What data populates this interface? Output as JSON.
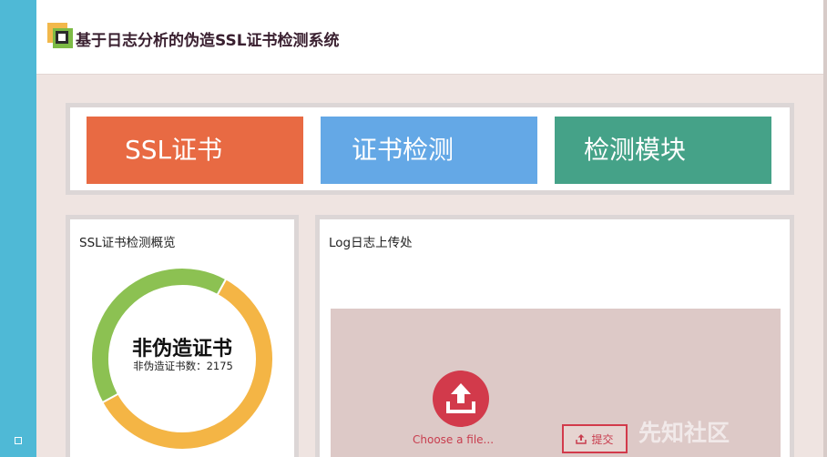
{
  "app": {
    "title": "基于日志分析的伪造SSL证书检测系统"
  },
  "nav": {
    "buttons": [
      "SSL证书",
      "证书检测",
      "检测模块"
    ]
  },
  "overview": {
    "title": "SSL证书检测概览",
    "donut_main_label": "非伪造证书",
    "donut_sub_label": "非伪造证书数：2175",
    "segments": [
      {
        "color": "#f4b545",
        "fraction": 0.59
      },
      {
        "color": "#8cc152",
        "fraction": 0.41
      }
    ]
  },
  "upload": {
    "title": "Log日志上传处",
    "choose_label": "Choose a file...",
    "submit_label": "提交",
    "watermark": "先知社区"
  },
  "icons": [
    "app-logo-icon",
    "upload-icon",
    "submit-upload-icon",
    "window-icon"
  ],
  "colors": {
    "sidebar": "#4fb9d6",
    "ssl": "#e86a43",
    "detect": "#64a8e6",
    "module": "#45a288",
    "accent": "#d23a4b"
  }
}
